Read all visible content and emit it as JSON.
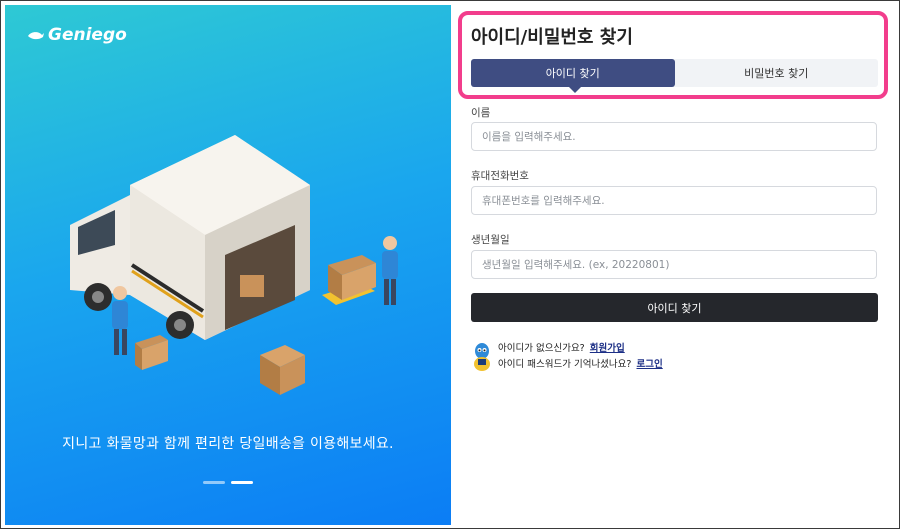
{
  "brand": {
    "logo_text": "Geniego"
  },
  "left": {
    "tagline": "지니고 화물망과 함께 편리한 당일배송을 이용해보세요."
  },
  "panel": {
    "title": "아이디/비밀번호 찾기",
    "tabs": [
      {
        "label": "아이디 찾기",
        "active": true
      },
      {
        "label": "비밀번호 찾기",
        "active": false
      }
    ]
  },
  "form": {
    "name_label": "이름",
    "name_placeholder": "이름을 입력해주세요.",
    "phone_label": "휴대전화번호",
    "phone_placeholder": "휴대폰번호를 입력해주세요.",
    "birth_label": "생년월일",
    "birth_placeholder": "생년월일 입력해주세요. (ex, 20220801)",
    "submit_label": "아이디 찾기"
  },
  "help": {
    "q1": "아이디가 없으신가요?",
    "link1": "회원가입",
    "q2": "아이디 패스워드가 기억나셨나요?",
    "link2": "로그인"
  },
  "colors": {
    "highlight": "#f23d8c",
    "tab_active": "#3f4d82",
    "button": "#25272c"
  },
  "carousel": {
    "slides": 2,
    "active_index": 1
  }
}
